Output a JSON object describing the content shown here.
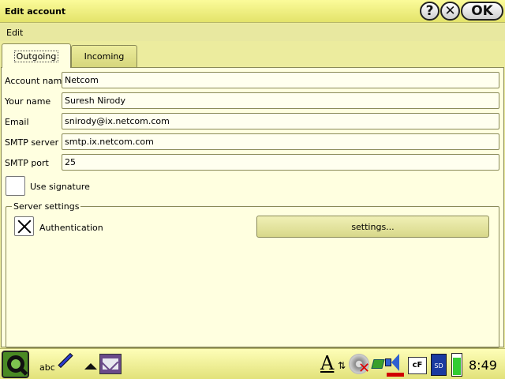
{
  "window": {
    "title": "Edit account",
    "help_label": "?",
    "close_label": "✕",
    "ok_label": "OK"
  },
  "menu": {
    "edit_label": "Edit"
  },
  "tabs": [
    {
      "label": "Outgoing",
      "selected": true
    },
    {
      "label": "Incoming",
      "selected": false
    }
  ],
  "form": {
    "account_name": {
      "label": "Account name",
      "value": "Netcom"
    },
    "your_name": {
      "label": "Your name",
      "value": "Suresh Nirody"
    },
    "email": {
      "label": "Email",
      "value": "snirody@ix.netcom.com"
    },
    "smtp_server": {
      "label": "SMTP server",
      "value": "smtp.ix.netcom.com"
    },
    "smtp_port": {
      "label": "SMTP port",
      "value": "25"
    },
    "use_signature": {
      "label": "Use signature",
      "checked": false
    }
  },
  "server_settings": {
    "legend": "Server settings",
    "authentication": {
      "label": "Authentication",
      "checked": true
    },
    "settings_button": "settings..."
  },
  "taskbar": {
    "input_method": "abc",
    "tray_font": "A",
    "tray_cf": "cF",
    "tray_sd": "SD",
    "clock": "8:49"
  },
  "colors": {
    "background": "#ecec9e",
    "panel": "#ffffe0",
    "titlebar": "#f5f58c",
    "battery": "#33cc33",
    "volume_indicator": "#d00000"
  }
}
